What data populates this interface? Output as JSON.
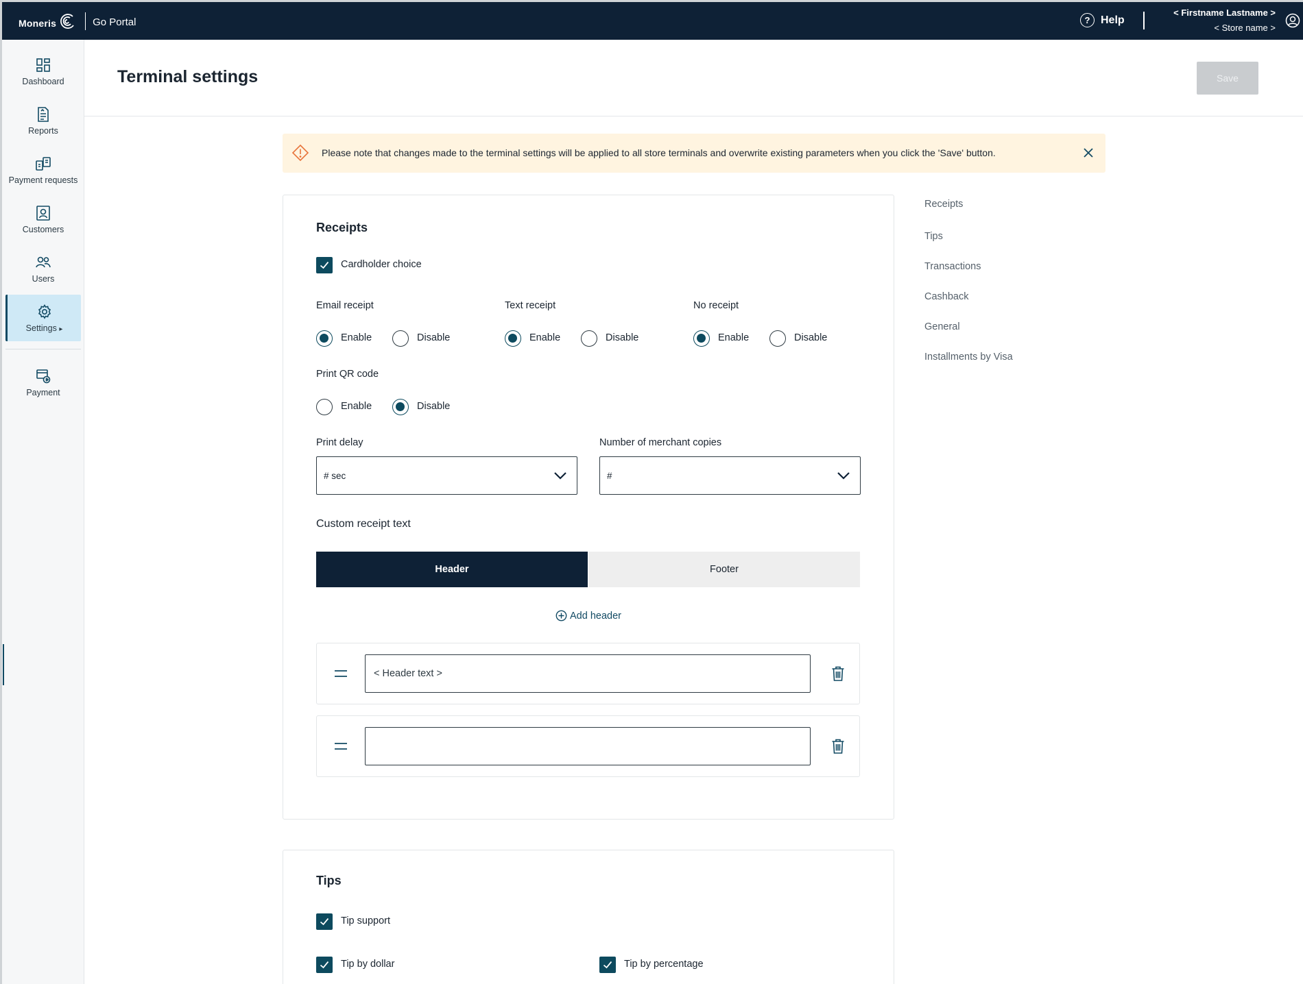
{
  "topbar": {
    "brand": "Moneris",
    "portal": "Go Portal",
    "help": "Help",
    "user_name": "< Firstname Lastname >",
    "store_name": "< Store name >"
  },
  "sidebar": {
    "items": [
      {
        "label": "Dashboard",
        "icon": "dashboard-icon"
      },
      {
        "label": "Reports",
        "icon": "reports-icon"
      },
      {
        "label": "Payment requests",
        "icon": "payment-requests-icon"
      },
      {
        "label": "Customers",
        "icon": "customers-icon"
      },
      {
        "label": "Users",
        "icon": "users-icon"
      },
      {
        "label": "Settings",
        "icon": "settings-icon",
        "active": true
      },
      {
        "label": "Payment",
        "icon": "payment-icon"
      }
    ]
  },
  "page": {
    "title": "Terminal settings",
    "save": "Save"
  },
  "alert": {
    "text": "Please note that changes made to the terminal settings will be applied to all store terminals and overwrite existing parameters when you click the 'Save' button.",
    "color": "#fff4e0"
  },
  "receipts": {
    "title": "Receipts",
    "cardholder_choice": "Cardholder choice",
    "email_receipt": {
      "label": "Email receipt",
      "enable": "Enable",
      "disable": "Disable",
      "selected": "Enable"
    },
    "text_receipt": {
      "label": "Text receipt",
      "enable": "Enable",
      "disable": "Disable",
      "selected": "Enable"
    },
    "no_receipt": {
      "label": "No receipt",
      "enable": "Enable",
      "disable": "Disable",
      "selected": "Enable"
    },
    "print_qr": {
      "label": "Print QR code",
      "enable": "Enable",
      "disable": "Disable",
      "selected": "Disable"
    },
    "print_delay": {
      "label": "Print delay",
      "value": "# sec"
    },
    "merchant_copies": {
      "label": "Number of merchant copies",
      "value": "#"
    },
    "custom_text": {
      "label": "Custom receipt text",
      "tabs": [
        "Header",
        "Footer"
      ],
      "active_tab": "Header",
      "add": "Add header",
      "rows": [
        {
          "placeholder": "< Header text >"
        },
        {
          "placeholder": ""
        }
      ]
    }
  },
  "tips": {
    "title": "Tips",
    "tip_support": "Tip support",
    "tip_by_dollar": "Tip by dollar",
    "tip_by_percentage": "Tip by percentage"
  },
  "anchors": [
    "Receipts",
    "Tips",
    "Transactions",
    "Cashback",
    "General",
    "Installments by Visa"
  ],
  "colors": {
    "navy": "#0e2136",
    "teal": "#0d4a5e",
    "active_nav_bg": "#cfe9f6",
    "alert_bg": "#fff4e0",
    "alert_icon": "#e8743b"
  }
}
